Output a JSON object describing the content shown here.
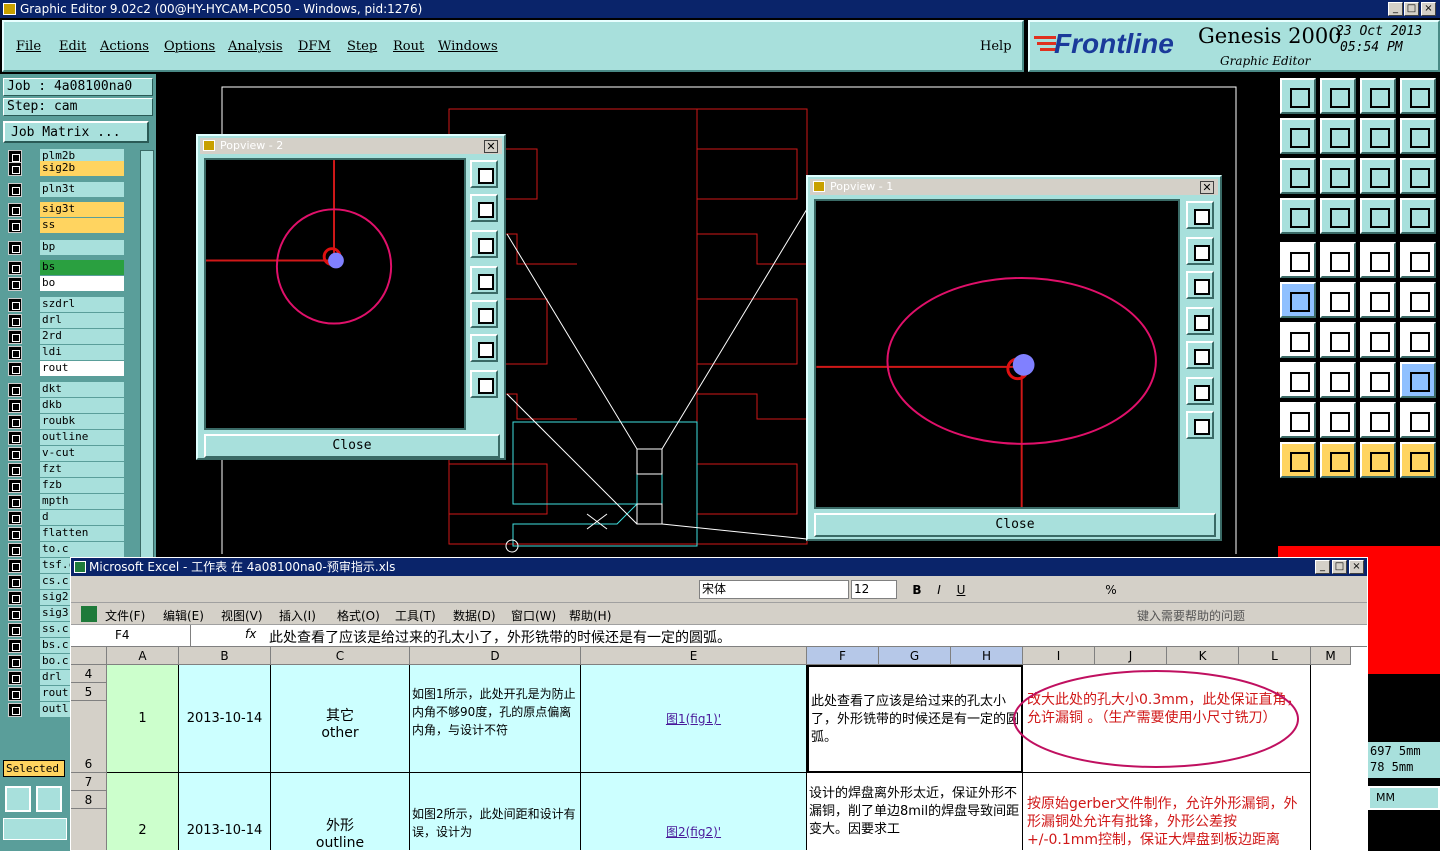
{
  "window": {
    "title": "Graphic Editor 9.02c2 (00@HY-HYCAM-PC050 - Windows, pid:1276)"
  },
  "menu": {
    "items": [
      "File",
      "Edit",
      "Actions",
      "Options",
      "Analysis",
      "DFM",
      "Step",
      "Rout",
      "Windows"
    ],
    "help": "Help"
  },
  "brand": {
    "logo": "Frontline",
    "product": "Genesis 2000",
    "subtitle": "Graphic Editor",
    "date": "23 Oct 2013",
    "time": "05:54 PM"
  },
  "job": {
    "job_line": "Job : 4a08100na0",
    "step_line": "Step: cam",
    "matrix_button": "Job Matrix ..."
  },
  "layers": [
    {
      "name": "plm2b",
      "color": "#a8e0dc"
    },
    {
      "name": "sig2b",
      "color": "#ffd460"
    },
    {
      "name": "pln3t",
      "color": "#a8e0dc"
    },
    {
      "name": "sig3t",
      "color": "#ffd460"
    },
    {
      "name": "ss",
      "color": "#ffd460"
    },
    {
      "name": "bp",
      "color": "#a8e0dc"
    },
    {
      "name": "bs",
      "color": "#2aa040"
    },
    {
      "name": "bo",
      "color": "#ffffff"
    },
    {
      "name": "szdrl",
      "color": "#a8e0dc"
    },
    {
      "name": "drl",
      "color": "#a8e0dc"
    },
    {
      "name": "2rd",
      "color": "#a8e0dc"
    },
    {
      "name": "ldi",
      "color": "#a8e0dc"
    },
    {
      "name": "rout",
      "color": "#ffffff"
    },
    {
      "name": "dkt",
      "color": "#a8e0dc"
    },
    {
      "name": "dkb",
      "color": "#a8e0dc"
    },
    {
      "name": "roubk",
      "color": "#a8e0dc"
    },
    {
      "name": "outline",
      "color": "#a8e0dc"
    },
    {
      "name": "v-cut",
      "color": "#a8e0dc"
    },
    {
      "name": "fzt",
      "color": "#a8e0dc"
    },
    {
      "name": "fzb",
      "color": "#a8e0dc"
    },
    {
      "name": "mpth",
      "color": "#a8e0dc"
    },
    {
      "name": "d",
      "color": "#a8e0dc"
    },
    {
      "name": "flatten",
      "color": "#a8e0dc"
    },
    {
      "name": "to.c",
      "color": "#a8e0dc"
    },
    {
      "name": "tsf.c",
      "color": "#a8e0dc"
    },
    {
      "name": "cs.c",
      "color": "#a8e0dc"
    },
    {
      "name": "sig2",
      "color": "#a8e0dc"
    },
    {
      "name": "sig3",
      "color": "#a8e0dc"
    },
    {
      "name": "ss.c",
      "color": "#a8e0dc"
    },
    {
      "name": "bs.c",
      "color": "#a8e0dc"
    },
    {
      "name": "bo.c",
      "color": "#a8e0dc"
    },
    {
      "name": "drl",
      "color": "#a8e0dc"
    },
    {
      "name": "rout",
      "color": "#a8e0dc"
    },
    {
      "name": "outl",
      "color": "#a8e0dc"
    }
  ],
  "selected_label": "Selected",
  "popview2": {
    "title": "Popview - 2",
    "close": "Close"
  },
  "popview1": {
    "title": "Popview - 1",
    "close": "Close"
  },
  "coords": {
    "x": "697 5mm",
    "y": "78 5mm",
    "unit": "MM"
  },
  "excel": {
    "title": "Microsoft Excel - 工作表 在 4a08100na0-预审指示.xls",
    "font_name": "宋体",
    "font_size": "12",
    "menu": [
      "文件(F)",
      "编辑(E)",
      "视图(V)",
      "插入(I)",
      "格式(O)",
      "工具(T)",
      "数据(D)",
      "窗口(W)",
      "帮助(H)"
    ],
    "help_placeholder": "键入需要帮助的问题",
    "name_box": "F4",
    "formula": "此处查看了应该是给过来的孔太小了，外形铣带的时候还是有一定的圆弧。",
    "columns": [
      "A",
      "B",
      "C",
      "D",
      "E",
      "F",
      "G",
      "H",
      "I",
      "J",
      "K",
      "L",
      "M"
    ],
    "row_numbers": [
      "4",
      "5",
      "6",
      "7",
      "8"
    ],
    "rows": [
      {
        "no": "1",
        "date": "2013-10-14",
        "type": "其它",
        "type_en": "other",
        "desc": "如图1所示，此处开孔是为防止内角不够90度，孔的原点偏离内角，与设计不符",
        "link": "图1(fig1)'",
        "reply": "此处查看了应该是给过来的孔太小了，外形铣带的时候还是有一定的圆弧。",
        "instruction": "改大此处的孔大小0.3mm，此处保证直角，允许漏铜 。（生产需要使用小尺寸铣刀）"
      },
      {
        "no": "2",
        "date": "2013-10-14",
        "type": "外形",
        "type_en": "outline",
        "desc": "如图2所示，此处间距和设计有误，设计为",
        "link": "图2(fig2)'",
        "reply": "设计的焊盘离外形太近，保证外形不漏铜，削了单边8mil的焊盘导致间距变大。因要求工",
        "instruction": "按原始gerber文件制作，允许外形漏铜，外形漏铜处允许有批锋，外形公差按+/-0.1mm控制，保证大焊盘到板边距离"
      }
    ]
  }
}
